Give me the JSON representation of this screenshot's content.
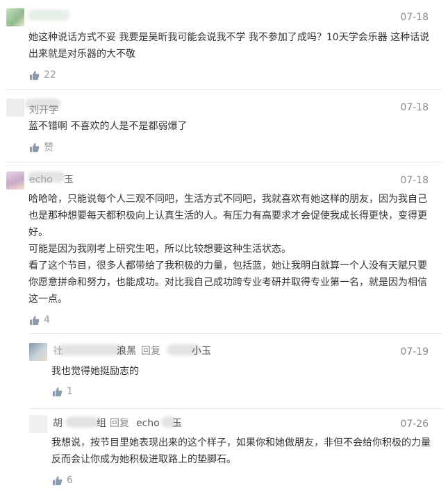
{
  "comments": [
    {
      "date": "07-18",
      "text": "她这种说话方式不妥 我要是吴昕我可能会说我不学 我不参加了成吗？10天学会乐器 这种话说出来就是对乐器的大不敬",
      "likes": "22"
    },
    {
      "username_visible": "刘开学",
      "date": "07-18",
      "text": "蓝不错啊 不喜欢的人是不是都弱爆了",
      "likes": "赞"
    },
    {
      "username_visible_a": "echo",
      "username_visible_b": "玉",
      "date": "07-18",
      "paragraphs": [
        "哈哈哈，只能说每个人三观不同吧，生活方式不同吧，我就喜欢有她这样的朋友，因为我自己也是那种想要每天都积极向上认真生活的人。有压力有高要求才会促使我成长得更快，变得更好。",
        "可能是因为我刚考上研究生吧，所以比较想要这种生活状态。",
        "看了这个节目，很多人都带给了我积极的力量，包括蓝，她让我明白就算一个人没有天赋只要你愿意拼命和努力，也能成功。对比我自己成功跨专业考研并取得专业第一名，就是因为相信这一点。"
      ],
      "likes": "4"
    }
  ],
  "replies": [
    {
      "username_visible_a": "社",
      "username_visible_b": "浪黑",
      "reply_label": "回复",
      "reply_to_visible": "小玉",
      "date": "07-19",
      "text": "我也觉得她挺励志的",
      "likes": "1"
    },
    {
      "username_visible_a": "胡",
      "username_visible_b": "组",
      "reply_label": "回复",
      "reply_to_visible_a": "echo",
      "reply_to_visible_b": "玉",
      "date": "07-26",
      "text": "我想说，按节目里她表现出来的这个样子，如果你和她做朋友，非但不会给你积极的力量反而会让你成为她积极进取路上的垫脚石。",
      "likes": "6"
    }
  ],
  "icons": {
    "like": "thumbs-up-icon"
  },
  "colors": {
    "muted": "#8a8a8a",
    "text": "#333333",
    "like_icon": "#8c9aae"
  }
}
